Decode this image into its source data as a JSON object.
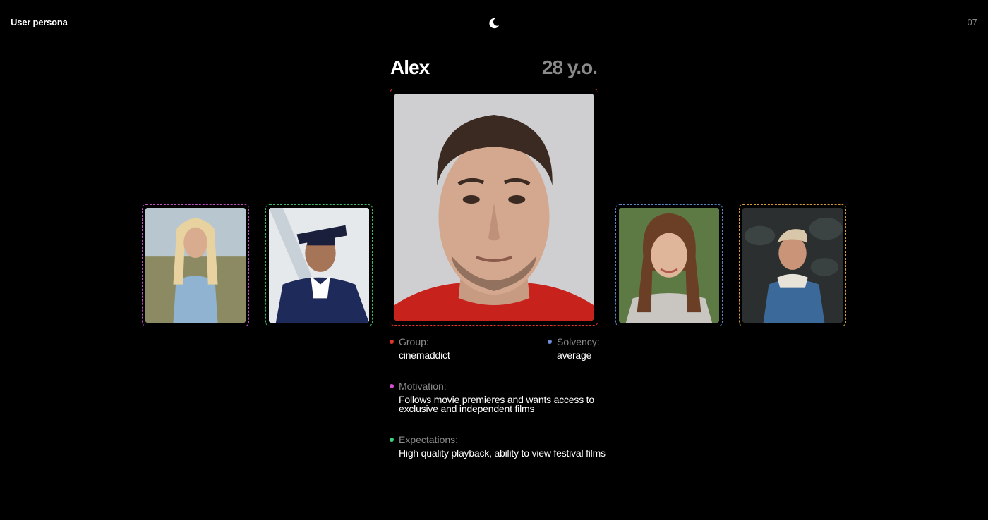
{
  "header": {
    "title": "User persona",
    "page_number": "07",
    "theme_icon": "moon-icon"
  },
  "persona": {
    "name": "Alex",
    "age": "28 y.o.",
    "accent_color": "#e0352b"
  },
  "thumbnails": [
    {
      "icon": "avatar-woman-blonde",
      "border_color": "#c04fc4"
    },
    {
      "icon": "avatar-graduate",
      "border_color": "#3fb86a"
    },
    {
      "icon": "avatar-woman-brunette",
      "border_color": "#5b87c9"
    },
    {
      "icon": "avatar-man-denim",
      "border_color": "#d89a3a"
    }
  ],
  "details": {
    "group": {
      "label": "Group:",
      "value": "cinemaddict",
      "color": "#e0352b"
    },
    "solvency": {
      "label": "Solvency:",
      "value": "average",
      "color": "#6d8ed6"
    },
    "motivation": {
      "label": "Motivation:",
      "value": "Follows movie premieres and wants access to exclusive and independent films",
      "color": "#d44fd0"
    },
    "expectations": {
      "label": "Expectations:",
      "value": "High quality playback, ability to view festival films",
      "color": "#3fd07a"
    }
  }
}
